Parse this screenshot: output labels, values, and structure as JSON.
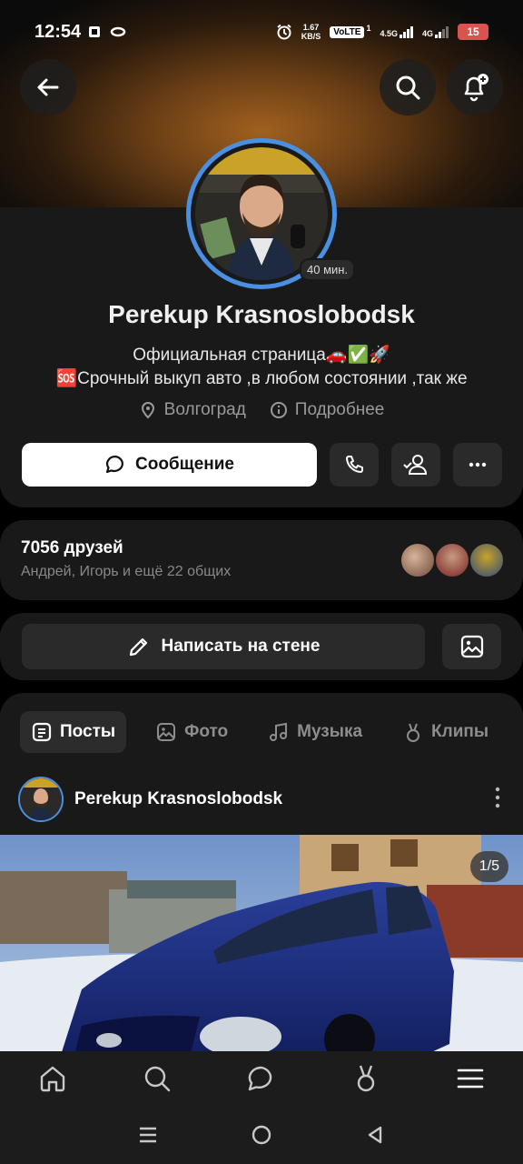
{
  "status_bar": {
    "time": "12:54",
    "net_speed_value": "1.67",
    "net_speed_unit": "KB/S",
    "volte": "VoLTE",
    "sim1": "1",
    "sig1_label": "4.5G",
    "sig2_label": "4G",
    "battery": "15"
  },
  "header": {
    "back_icon": "arrow-left-icon",
    "search_icon": "search-icon",
    "notify_icon": "bell-plus-icon"
  },
  "profile": {
    "name": "Perekup Krasnoslobodsk",
    "online": "40 мин.",
    "bio_line1": "Официальная страница🚗✅🚀",
    "bio_line2": "🆘Срочный выкуп авто ,в любом состоянии ,так же",
    "city": "Волгоград",
    "details": "Подробнее",
    "message_button": "Сообщение"
  },
  "friends": {
    "title": "7056 друзей",
    "subtitle": "Андрей, Игорь и ещё 22 общих"
  },
  "wall": {
    "write_button": "Написать на стене"
  },
  "tabs": [
    {
      "label": "Посты",
      "icon": "posts-icon",
      "active": true
    },
    {
      "label": "Фото",
      "icon": "photo-icon",
      "active": false
    },
    {
      "label": "Музыка",
      "icon": "music-icon",
      "active": false
    },
    {
      "label": "Клипы",
      "icon": "clips-icon",
      "active": false
    }
  ],
  "post": {
    "author": "Perekup Krasnoslobodsk",
    "counter": "1/5"
  },
  "colors": {
    "accent_ring": "#4a90e2",
    "card_bg": "#191919"
  }
}
